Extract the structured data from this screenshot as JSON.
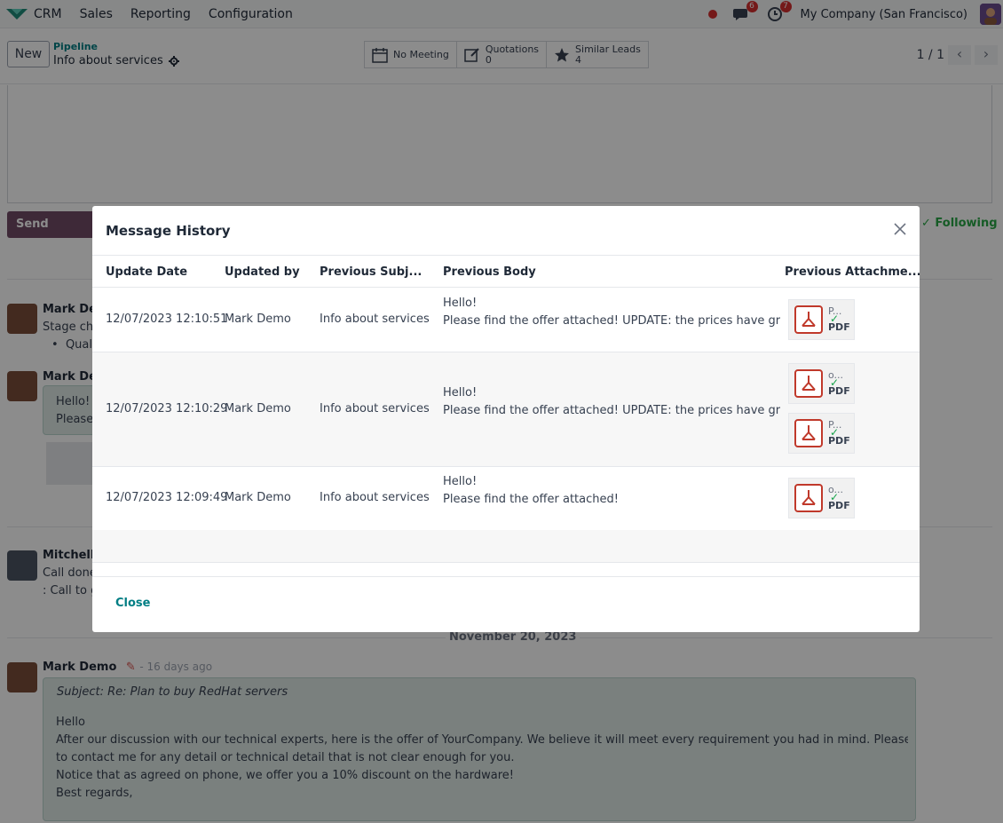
{
  "navbar": {
    "app_name": "CRM",
    "menu": [
      "Sales",
      "Reporting",
      "Configuration"
    ],
    "messages_count": "6",
    "activities_count": "7",
    "company": "My Company (San Francisco)"
  },
  "control_panel": {
    "new_label": "New",
    "breadcrumb_parent": "Pipeline",
    "breadcrumb_current": "Info about services",
    "smart_buttons": {
      "meeting": "No Meeting",
      "quotations_label": "Quotations",
      "quotations_count": "0",
      "similar_label": "Similar Leads",
      "similar_count": "4"
    },
    "pager": "1 / 1"
  },
  "chatter": {
    "send_label": "Send message",
    "following_label": "Following",
    "msg1_author": "Mark Dem",
    "msg1_line": "Stage cha",
    "msg1_bullet": "Qual",
    "msg2_author": "Mark Dem",
    "msg2_line1": "Hello!",
    "msg2_line2": "Please",
    "msg3_author": "Mitchell",
    "msg3_line1": "Call done",
    "msg3_line2": ": Call to g",
    "date_separator": "November 20, 2023",
    "msg4_author": "Mark Demo",
    "msg4_meta": "- 16 days ago",
    "msg4_subject": "Subject: Re: Plan to buy RedHat servers",
    "msg4_line1": "Hello",
    "msg4_line2": "After our discussion with our technical experts, here is the offer of YourCompany. We believe it will meet every requirement you had in mind. Please feel free",
    "msg4_line3": "to contact me for any detail or technical detail that is not clear enough for you.",
    "msg4_line4": "Notice that as agreed on phone, we offer you a 10% discount on the hardware!",
    "msg4_line5": "Best regards,"
  },
  "modal": {
    "title": "Message History",
    "columns": [
      "Update Date",
      "Updated by",
      "Previous Subj...",
      "Previous Body",
      "Previous Attachme..."
    ],
    "rows": [
      {
        "date": "12/07/2023 12:10:51",
        "by": "Mark Demo",
        "subject": "Info about services",
        "body1": "Hello!",
        "body2": "Please find the offer attached! UPDATE: the prices have grown",
        "attachments": [
          {
            "name": "P...",
            "ext": "PDF"
          }
        ]
      },
      {
        "date": "12/07/2023 12:10:29",
        "by": "Mark Demo",
        "subject": "Info about services",
        "body1": "Hello!",
        "body2": "Please find the offer attached! UPDATE: the prices have grown",
        "attachments": [
          {
            "name": "o...",
            "ext": "PDF"
          },
          {
            "name": "P...",
            "ext": "PDF"
          }
        ]
      },
      {
        "date": "12/07/2023 12:09:49",
        "by": "Mark Demo",
        "subject": "Info about services",
        "body1": "Hello!",
        "body2": "Please find the offer attached!",
        "attachments": [
          {
            "name": "o...",
            "ext": "PDF"
          }
        ]
      }
    ],
    "close_label": "Close"
  },
  "colors": {
    "brand": "#714b67",
    "link": "#017e84",
    "badge": "#d32f2f",
    "success": "#28a745"
  }
}
